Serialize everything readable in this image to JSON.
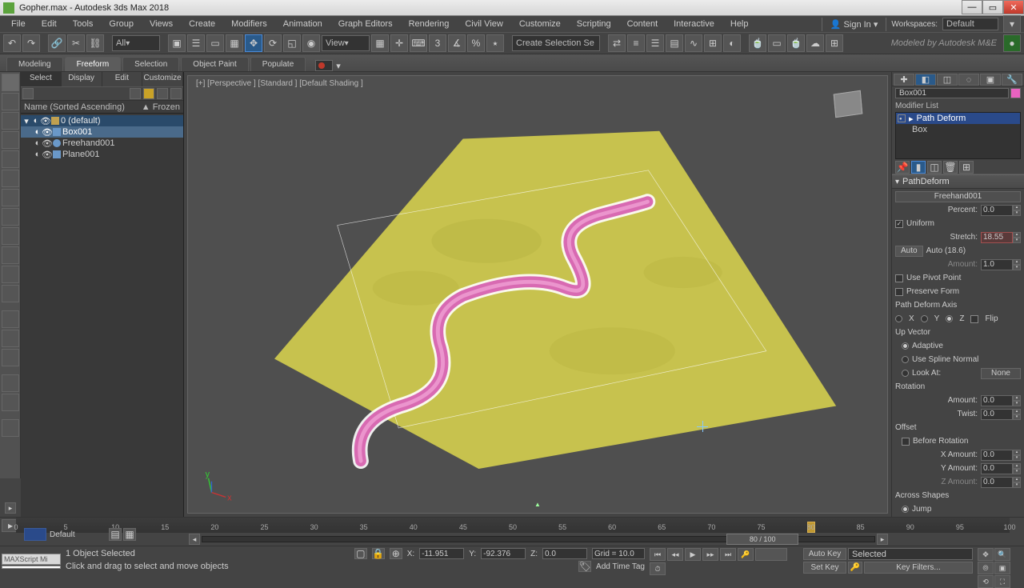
{
  "window": {
    "title": "Gopher.max - Autodesk 3ds Max 2018"
  },
  "menu": [
    "File",
    "Edit",
    "Tools",
    "Group",
    "Views",
    "Create",
    "Modifiers",
    "Animation",
    "Graph Editors",
    "Rendering",
    "Civil View",
    "Customize",
    "Scripting",
    "Content",
    "Interactive",
    "Help"
  ],
  "signin": "Sign In",
  "workspaces_label": "Workspaces:",
  "workspaces_value": "Default",
  "brand": "Modeled by Autodesk M&E",
  "toolbar_filter": "All",
  "toolbar_view": "View",
  "toolbar_selset": "Create Selection Se",
  "ribbon": [
    "Modeling",
    "Freeform",
    "Selection",
    "Object Paint",
    "Populate"
  ],
  "ribbon_active": 1,
  "explorer": {
    "tabs": [
      "Select",
      "Display",
      "Edit",
      "Customize"
    ],
    "col_name": "Name (Sorted Ascending)",
    "col_frozen": "Frozen",
    "root": "0 (default)",
    "items": [
      {
        "label": "Box001",
        "icon": "box",
        "sel": true
      },
      {
        "label": "Freehand001",
        "icon": "sp",
        "sel": false
      },
      {
        "label": "Plane001",
        "icon": "box",
        "sel": false
      }
    ]
  },
  "viewport": {
    "label": "[+] [Perspective ] [Standard ] [Default Shading ]"
  },
  "object_name": "Box001",
  "modlist_label": "Modifier List",
  "modstack": [
    {
      "label": "Path Deform",
      "sel": true
    },
    {
      "label": "Box",
      "sel": false
    }
  ],
  "pathdeform": {
    "title": "PathDeform",
    "spline": "Freehand001",
    "percent_label": "Percent:",
    "percent_val": "0.0",
    "uniform": "Uniform",
    "stretch_label": "Stretch:",
    "stretch_val": "18.55",
    "auto_btn": "Auto",
    "auto_field": "Auto (18.6)",
    "amount_dim_label": "Amount:",
    "amount_dim_val": "1.0",
    "pivot": "Use Pivot Point",
    "preserve": "Preserve Form",
    "axis_label": "Path Deform Axis",
    "axis": [
      "X",
      "Y",
      "Z"
    ],
    "flip": "Flip",
    "upvec": "Up Vector",
    "adaptive": "Adaptive",
    "use_spline_normal": "Use Spline Normal",
    "lookat": "Look At:",
    "none": "None",
    "rotation": "Rotation",
    "rot_amount_label": "Amount:",
    "rot_amount": "0.0",
    "twist_label": "Twist:",
    "twist": "0.0",
    "offset": "Offset",
    "before_rot": "Before Rotation",
    "x_amount_label": "X Amount:",
    "x_amount": "0.0",
    "y_amount_label": "Y Amount:",
    "y_amount": "0.0",
    "z_amount_label": "Z Amount:",
    "z_amount": "0.0",
    "across": "Across Shapes",
    "jump": "Jump"
  },
  "slider_text": "80 / 100",
  "track": {
    "range": [
      0,
      100
    ]
  },
  "status": {
    "selected": "1 Object Selected",
    "prompt": "Click and drag to select and move objects",
    "x": "-11.951",
    "y": "-92.376",
    "z": "0.0",
    "grid": "Grid = 10.0",
    "addtag": "Add Time Tag",
    "mxs": "MAXScript Mi"
  },
  "autokey": "Auto Key",
  "setkey": "Set Key",
  "anim_selected": "Selected",
  "keyfilters": "Key Filters...",
  "material_default": "Default"
}
